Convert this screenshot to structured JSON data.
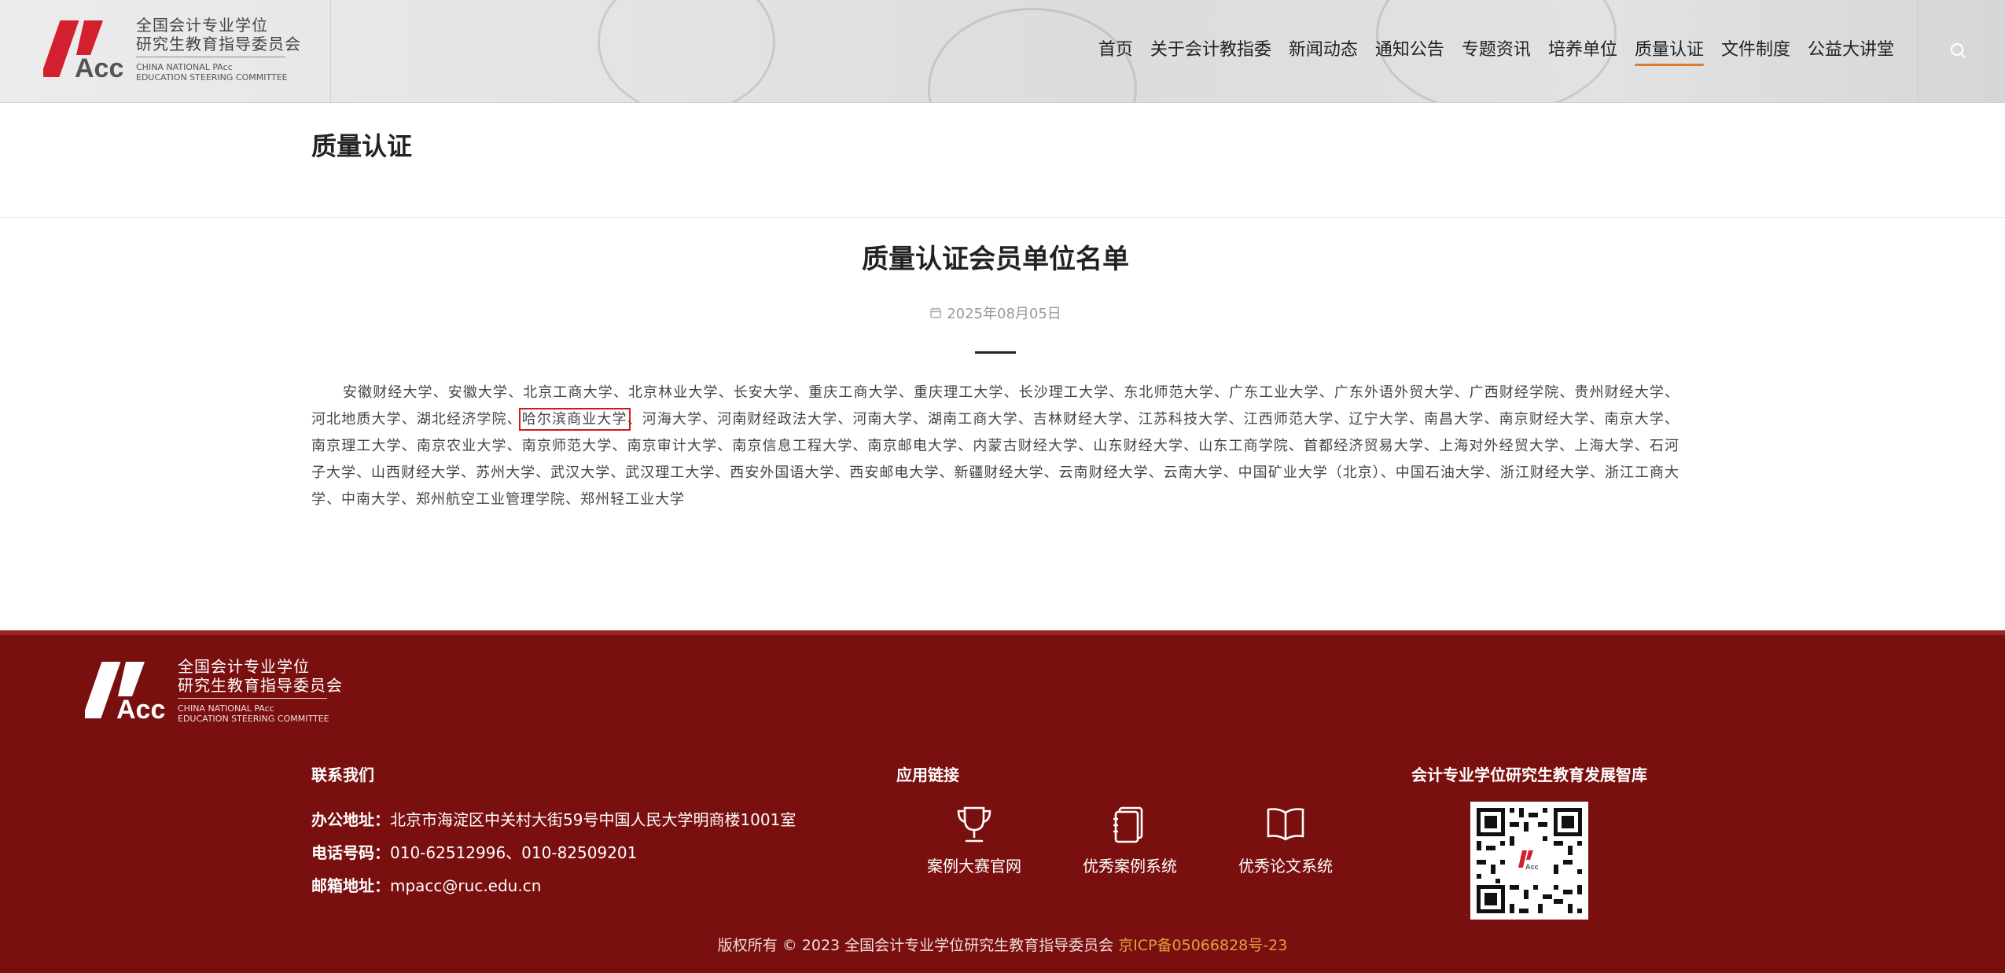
{
  "header": {
    "logo": {
      "mark": "PAcc",
      "cn_line1": "全国会计专业学位",
      "cn_line2": "研究生教育指导委员会",
      "en_line1": "CHINA NATIONAL PAcc",
      "en_line2": "EDUCATION STEERING COMMITTEE"
    },
    "nav": [
      {
        "label": "首页",
        "active": false
      },
      {
        "label": "关于会计教指委",
        "active": false
      },
      {
        "label": "新闻动态",
        "active": false
      },
      {
        "label": "通知公告",
        "active": false
      },
      {
        "label": "专题资讯",
        "active": false
      },
      {
        "label": "培养单位",
        "active": false
      },
      {
        "label": "质量认证",
        "active": true
      },
      {
        "label": "文件制度",
        "active": false
      },
      {
        "label": "公益大讲堂",
        "active": false
      }
    ],
    "search_icon": "search-icon"
  },
  "page": {
    "title": "质量认证"
  },
  "article": {
    "title": "质量认证会员单位名单",
    "date": "2025年08月05日",
    "date_icon": "calendar-icon",
    "body_before": "安徽财经大学、安徽大学、北京工商大学、北京林业大学、长安大学、重庆工商大学、重庆理工大学、长沙理工大学、东北师范大学、广东工业大学、广东外语外贸大学、广西财经学院、贵州财经大学、河北地质大学、湖北经济学院、",
    "body_highlight": "哈尔滨商业大学",
    "body_after": "、河海大学、河南财经政法大学、河南大学、湖南工商大学、吉林财经大学、江苏科技大学、江西师范大学、辽宁大学、南昌大学、南京财经大学、南京大学、南京理工大学、南京农业大学、南京师范大学、南京审计大学、南京信息工程大学、南京邮电大学、内蒙古财经大学、山东财经大学、山东工商学院、首都经济贸易大学、上海对外经贸大学、上海大学、石河子大学、山西财经大学、苏州大学、武汉大学、武汉理工大学、西安外国语大学、西安邮电大学、新疆财经大学、云南财经大学、云南大学、中国矿业大学（北京）、中国石油大学、浙江财经大学、浙江工商大学、中南大学、郑州航空工业管理学院、郑州轻工业大学"
  },
  "footer": {
    "logo": {
      "mark": "PAcc",
      "cn_line1": "全国会计专业学位",
      "cn_line2": "研究生教育指导委员会",
      "en_line1": "CHINA NATIONAL PAcc",
      "en_line2": "EDUCATION STEERING COMMITTEE"
    },
    "contact": {
      "heading": "联系我们",
      "address_label": "办公地址：",
      "address": "北京市海淀区中关村大街59号中国人民大学明商楼1001室",
      "phone_label": "电话号码：",
      "phone": "010-62512996、010-82509201",
      "email_label": "邮箱地址：",
      "email": "mpacc@ruc.edu.cn"
    },
    "links": {
      "heading": "应用链接",
      "items": [
        {
          "label": "案例大赛官网",
          "icon": "trophy-icon"
        },
        {
          "label": "优秀案例系统",
          "icon": "notebook-icon"
        },
        {
          "label": "优秀论文系统",
          "icon": "open-book-icon"
        }
      ]
    },
    "qr": {
      "heading": "会计专业学位研究生教育发展智库",
      "icon": "qr-code-icon"
    },
    "copyright": "版权所有 © 2023 全国会计专业学位研究生教育指导委员会",
    "icp": "京ICP备05066828号-23"
  },
  "colors": {
    "footer_bg": "#7a0f0f",
    "accent_underline": "#e07a2e",
    "logo_red": "#d3202f",
    "highlight_box": "#d01a1a"
  }
}
